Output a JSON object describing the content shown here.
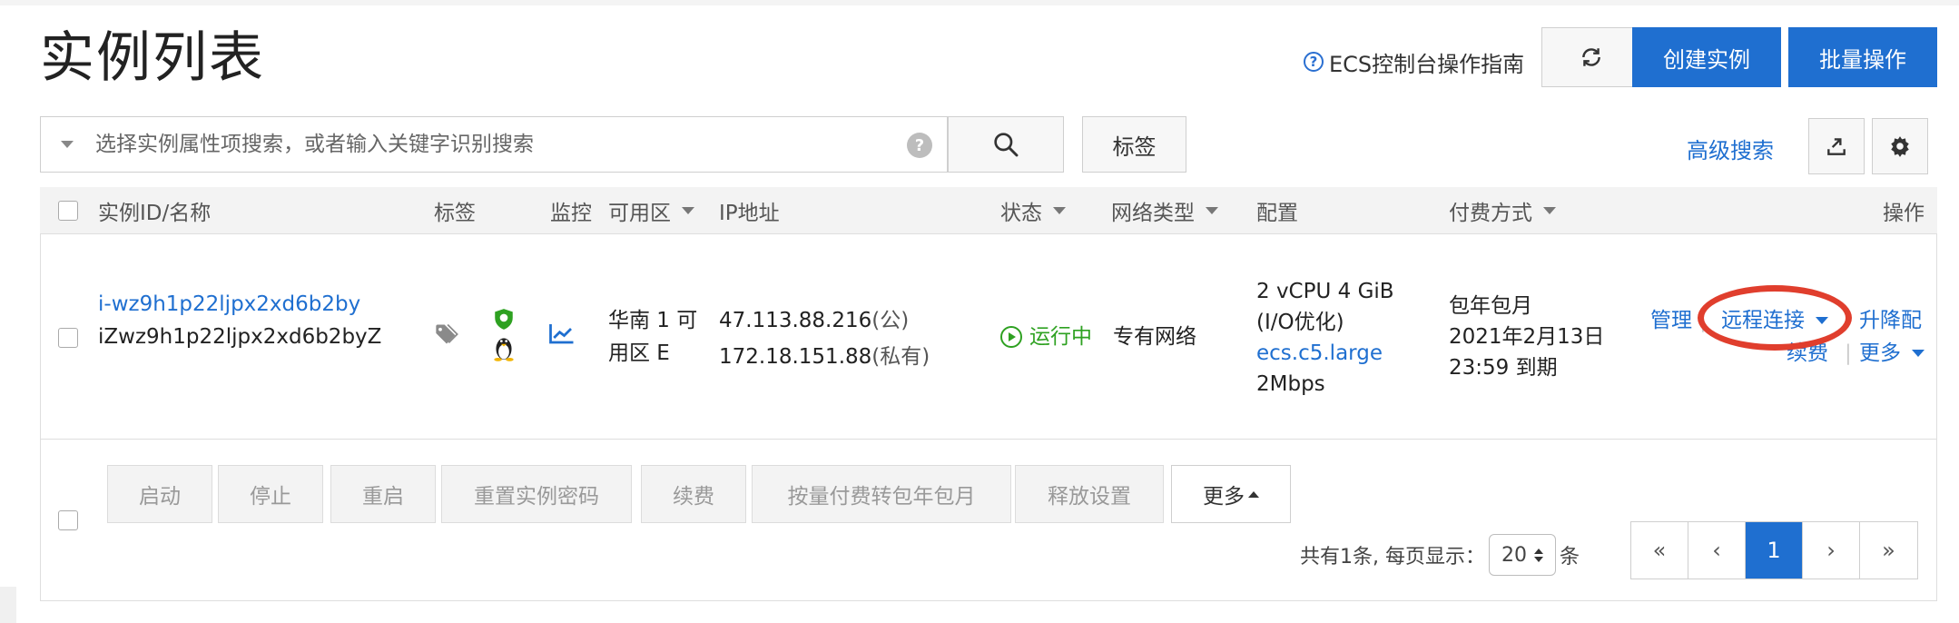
{
  "page": {
    "title": "实例列表"
  },
  "header": {
    "guide_label": "ECS控制台操作指南",
    "create_label": "创建实例",
    "batch_label": "批量操作"
  },
  "search": {
    "placeholder": "选择实例属性项搜索，或者输入关键字识别搜索",
    "help": "?",
    "tag_label": "标签",
    "advanced_label": "高级搜索"
  },
  "table": {
    "columns": {
      "id": "实例ID/名称",
      "tag": "标签",
      "monitor": "监控",
      "zone": "可用区",
      "ip": "IP地址",
      "status": "状态",
      "network": "网络类型",
      "config": "配置",
      "billing": "付费方式",
      "ops": "操作"
    },
    "rows": [
      {
        "id": "i-wz9h1p22ljpx2xd6b2by",
        "name": "iZwz9h1p22ljpx2xd6b2byZ",
        "zone_line1": "华南 1 可",
        "zone_line2": "用区 E",
        "public_ip": "47.113.88.216",
        "public_suffix": "(公)",
        "private_ip": "172.18.151.88",
        "private_suffix": "(私有)",
        "status": "运行中",
        "network": "专有网络",
        "config_line1": "2 vCPU 4 GiB",
        "config_line2": "(I/O优化)",
        "config_type": "ecs.c5.large",
        "bandwidth": "2Mbps",
        "billing_type": "包年包月",
        "expire_date": "2021年2月13日",
        "expire_time": "23:59 到期",
        "actions": {
          "manage": "管理",
          "remote": "远程连接",
          "upgrade": "升降配",
          "renew": "续费",
          "more": "更多"
        }
      }
    ]
  },
  "footer": {
    "buttons": {
      "start": "启动",
      "stop": "停止",
      "restart": "重启",
      "reset_password": "重置实例密码",
      "renew": "续费",
      "convert": "按量付费转包年包月",
      "release": "释放设置",
      "more": "更多"
    },
    "total_text": "共有1条, 每页显示：",
    "page_size": "20",
    "unit": "条"
  },
  "pager": {
    "first": "«",
    "prev": "‹",
    "current": "1",
    "next": "›",
    "last": "»"
  },
  "colors": {
    "accent": "#1f6fd0",
    "running": "#2ea121",
    "highlight": "#e03e2d"
  }
}
